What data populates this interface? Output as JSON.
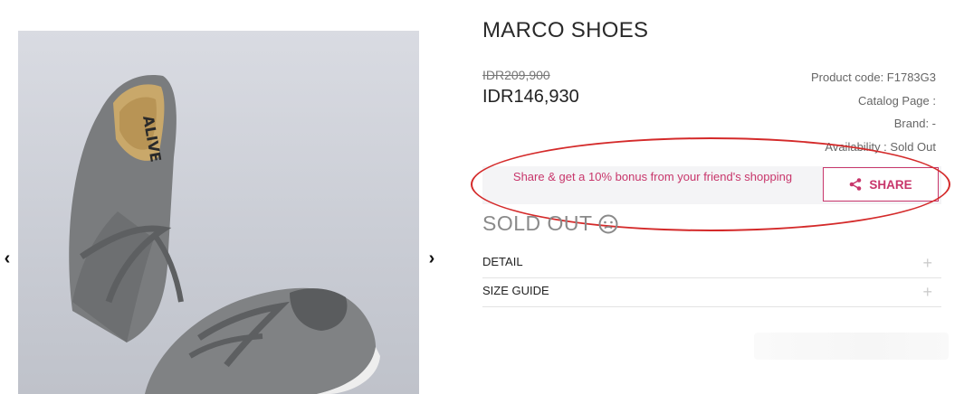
{
  "product": {
    "name": "MARCO SHOES",
    "old_price": "IDR209,900",
    "price": "IDR146,930",
    "image_icon": "shoe-photo"
  },
  "meta": {
    "product_code": "Product code: F1783G3",
    "catalog_page": "Catalog Page :",
    "brand": "Brand: -",
    "availability": "Availability : Sold Out"
  },
  "gallery": {
    "prev_icon": "chevron-left-icon",
    "next_icon": "chevron-right-icon",
    "prev_glyph": "‹",
    "next_glyph": "›",
    "logo_text": "ALIVE"
  },
  "share": {
    "text": "Share & get a 10% bonus from your friend's shopping",
    "button_label": "SHARE",
    "icon": "share-icon"
  },
  "status": {
    "sold_out": "SOLD OUT",
    "icon": "sad-face-icon"
  },
  "accordion": [
    {
      "label": "DETAIL",
      "toggle": "+"
    },
    {
      "label": "SIZE GUIDE",
      "toggle": "+"
    }
  ],
  "colors": {
    "accent": "#c8366b",
    "highlight": "#d42a2a"
  }
}
